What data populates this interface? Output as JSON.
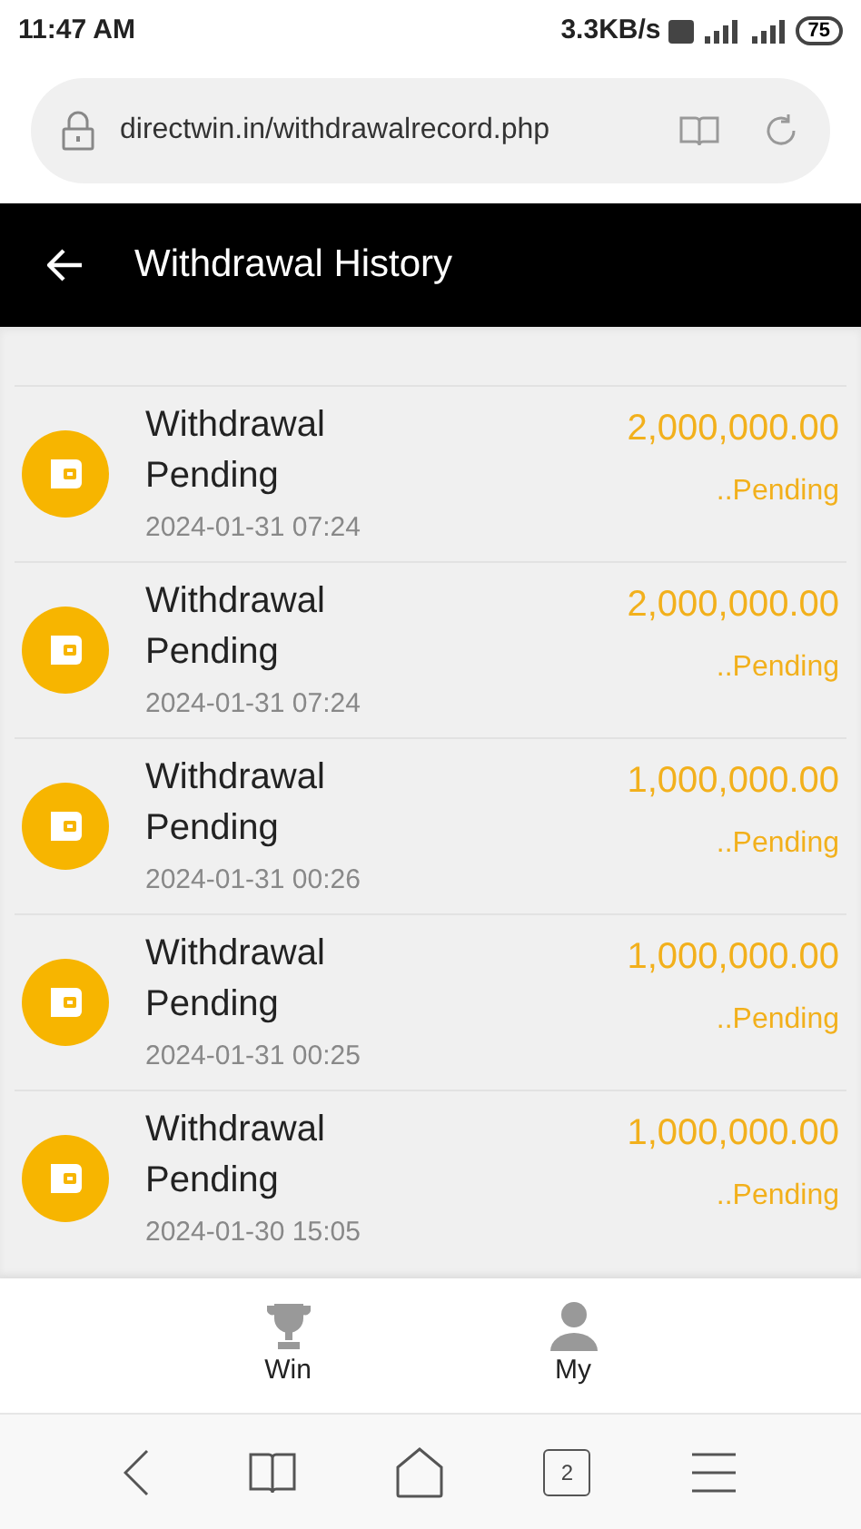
{
  "status_bar": {
    "time": "11:47 AM",
    "speed": "3.3KB/s",
    "battery": "75"
  },
  "browser": {
    "url": "directwin.in/withdrawalrecord.php",
    "tab_count": "2"
  },
  "header": {
    "title": "Withdrawal History"
  },
  "records": [
    {
      "title": "Withdrawal Pending",
      "amount": "2,000,000.00",
      "status": "..Pending",
      "date": "2024-01-31 07:24"
    },
    {
      "title": "Withdrawal Pending",
      "amount": "2,000,000.00",
      "status": "..Pending",
      "date": "2024-01-31 07:24"
    },
    {
      "title": "Withdrawal Pending",
      "amount": "1,000,000.00",
      "status": "..Pending",
      "date": "2024-01-31 00:26"
    },
    {
      "title": "Withdrawal Pending",
      "amount": "1,000,000.00",
      "status": "..Pending",
      "date": "2024-01-31 00:25"
    },
    {
      "title": "Withdrawal Pending",
      "amount": "1,000,000.00",
      "status": "..Pending",
      "date": "2024-01-30 15:05"
    }
  ],
  "nav": [
    {
      "kind": "trophy",
      "label": "Win"
    },
    {
      "kind": "person",
      "label": "My"
    }
  ]
}
